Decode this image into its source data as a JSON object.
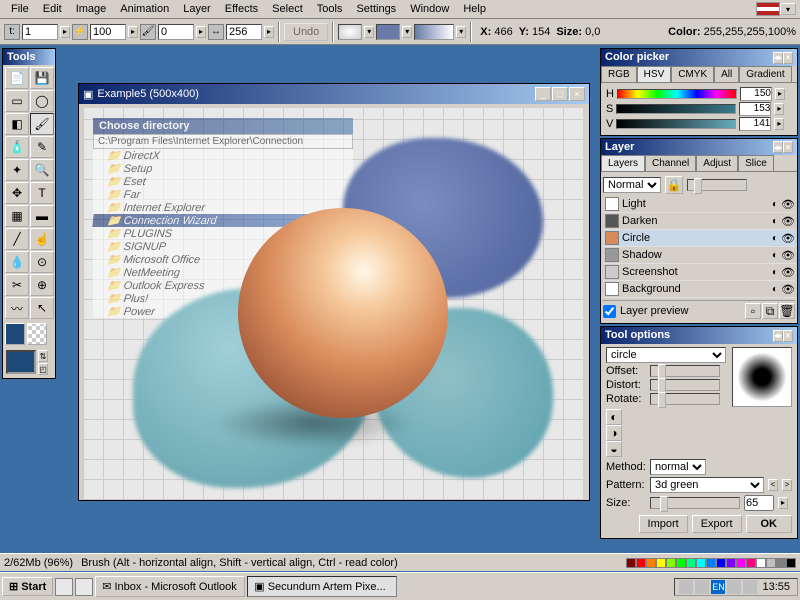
{
  "menu": {
    "items": [
      "File",
      "Edit",
      "Image",
      "Animation",
      "Layer",
      "Effects",
      "Select",
      "Tools",
      "Settings",
      "Window",
      "Help"
    ]
  },
  "toolbar": {
    "opacity_icon": "t:",
    "opacity": "1",
    "zoom_icon": "⚡",
    "zoom": "100",
    "brush_icon": "🖌",
    "brush": "0",
    "step_icon": "↔",
    "step": "256",
    "undo": "Undo",
    "x_label": "X:",
    "x": "466",
    "y_label": "Y:",
    "y": "154",
    "size_label": "Size:",
    "size": "0,0",
    "color_label": "Color:",
    "color": "255,255,255,100%"
  },
  "tools_panel": {
    "title": "Tools"
  },
  "canvas": {
    "title": "Example5",
    "dims": "(500x400)",
    "dir_title": "Choose directory",
    "dir_path": "C:\\Program Files\\Internet Explorer\\Connection",
    "dir_items": [
      "DirectX",
      "Setup",
      "Eset",
      "Far",
      "Internet Explorer",
      "Connection Wizard",
      "PLUGINS",
      "SIGNUP",
      "Microsoft Office",
      "NetMeeting",
      "Outlook Express",
      "Plus!",
      "Power"
    ]
  },
  "color_picker": {
    "title": "Color picker",
    "tabs": [
      "RGB",
      "HSV",
      "CMYK",
      "All",
      "Gradient"
    ],
    "h_label": "H",
    "h": "150",
    "s_label": "S",
    "s": "153",
    "v_label": "V",
    "v": "141"
  },
  "layer_panel": {
    "title": "Layer",
    "tabs": [
      "Layers",
      "Channel",
      "Adjust",
      "Slice"
    ],
    "blend": "Normal",
    "layers": [
      {
        "name": "Light",
        "thumb": "#fff"
      },
      {
        "name": "Darken",
        "thumb": "#555"
      },
      {
        "name": "Circle",
        "thumb": "#d88a5a"
      },
      {
        "name": "Shadow",
        "thumb": "#999"
      },
      {
        "name": "Screenshot",
        "thumb": "#ccc"
      },
      {
        "name": "Background",
        "thumb": "#fff"
      }
    ],
    "preview_label": "Layer preview"
  },
  "tool_options": {
    "title": "Tool options",
    "shape": "circle",
    "offset_label": "Offset:",
    "distort_label": "Distort:",
    "rotate_label": "Rotate:",
    "method_label": "Method:",
    "method": "normal",
    "pattern_label": "Pattern:",
    "pattern": "3d green",
    "size_label": "Size:",
    "size": "65",
    "import": "Import",
    "export": "Export",
    "ok": "OK"
  },
  "status": {
    "mem": "2/62Mb (96%)",
    "hint": "Brush (Alt - horizontal align, Shift - vertical align, Ctrl - read color)"
  },
  "taskbar": {
    "start": "Start",
    "task1": "Inbox - Microsoft Outlook",
    "task2": "Secundum Artem Pixe...",
    "clock": "13:55",
    "lang": "EN"
  },
  "palette_colors": [
    "#800000",
    "#f00",
    "#ff8000",
    "#ff0",
    "#80ff00",
    "#0f0",
    "#00ff80",
    "#0ff",
    "#0080ff",
    "#00f",
    "#8000ff",
    "#f0f",
    "#ff0080",
    "#fff",
    "#c0c0c0",
    "#808080",
    "#000"
  ]
}
